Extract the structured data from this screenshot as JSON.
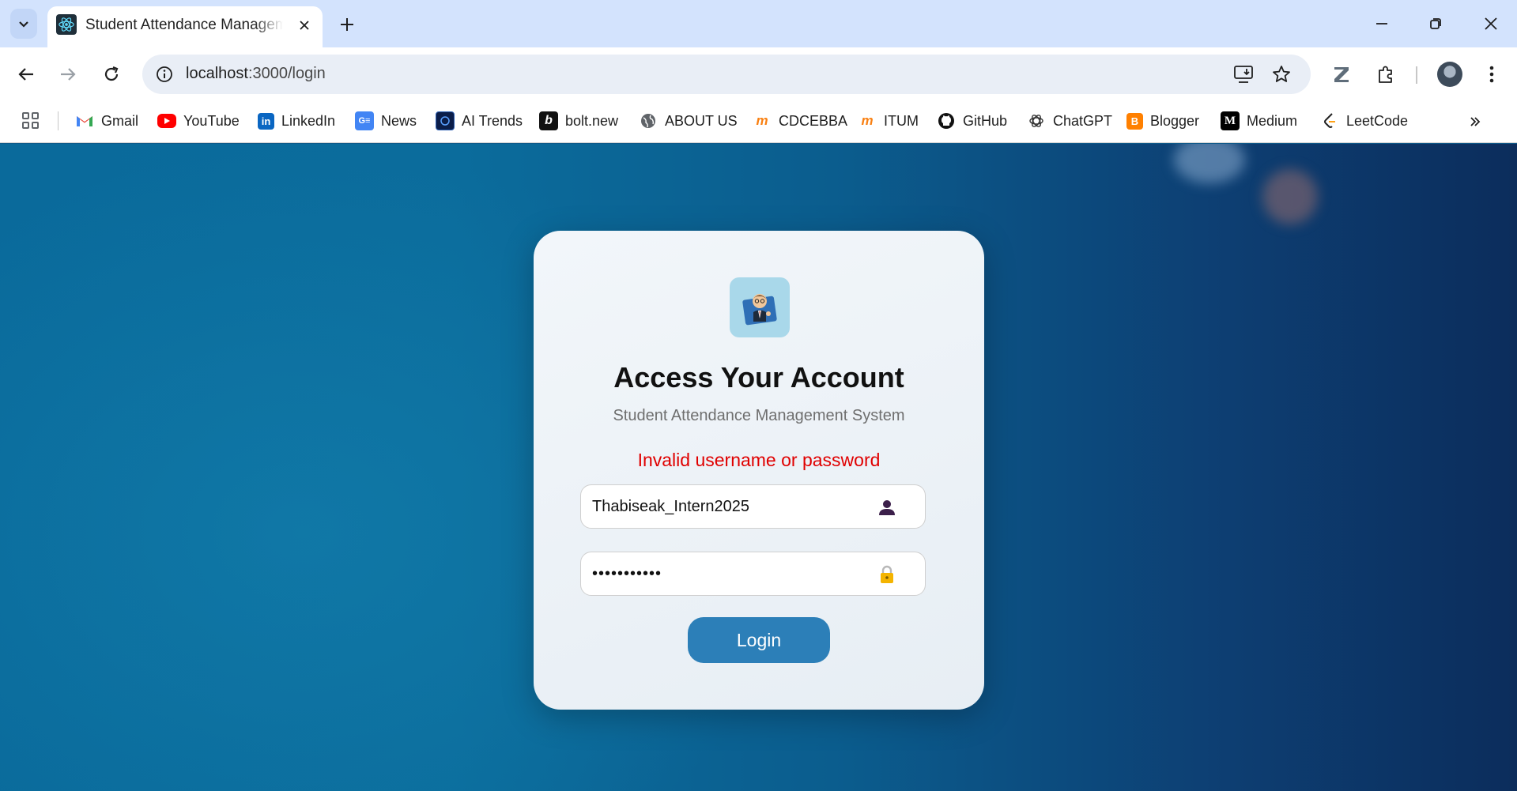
{
  "browser": {
    "tab_title": "Student Attendance Management System",
    "url_host": "localhost",
    "url_path": ":3000/login",
    "icons": {
      "tab_search": "chevron-down-icon",
      "new_tab": "plus-icon",
      "minimize": "minimize-icon",
      "restore": "restore-icon",
      "close": "close-icon",
      "back": "back-arrow-icon",
      "forward": "forward-arrow-icon",
      "reload": "reload-icon",
      "site_info": "info-icon",
      "install": "install-app-icon",
      "bookmark_star": "star-icon",
      "extension_z": "z-extension-icon",
      "extensions": "puzzle-icon",
      "menu": "kebab-menu-icon"
    }
  },
  "bookmarks": [
    {
      "label": "Gmail",
      "icon": "gmail-icon",
      "color": "#ea4335"
    },
    {
      "label": "YouTube",
      "icon": "youtube-icon",
      "color": "#ff0000"
    },
    {
      "label": "LinkedIn",
      "icon": "linkedin-icon",
      "color": "#0a66c2"
    },
    {
      "label": "News",
      "icon": "google-news-icon",
      "color": "#4285f4"
    },
    {
      "label": "AI Trends",
      "icon": "ai-trends-icon",
      "color": "#0b1e4a"
    },
    {
      "label": "bolt.new",
      "icon": "bolt-icon",
      "color": "#111111"
    },
    {
      "label": "ABOUT US",
      "icon": "globe-icon",
      "color": "#5f6368"
    },
    {
      "label": "CDCEBBA",
      "icon": "moodle-icon",
      "color": "#f98012"
    },
    {
      "label": "ITUM",
      "icon": "moodle-icon",
      "color": "#f98012"
    },
    {
      "label": "GitHub",
      "icon": "github-icon",
      "color": "#111111"
    },
    {
      "label": "ChatGPT",
      "icon": "chatgpt-icon",
      "color": "#333333"
    },
    {
      "label": "Blogger",
      "icon": "blogger-icon",
      "color": "#ff8000"
    },
    {
      "label": "Medium",
      "icon": "medium-icon",
      "color": "#000000"
    },
    {
      "label": "LeetCode",
      "icon": "leetcode-icon",
      "color": "#ffa116"
    }
  ],
  "login": {
    "title": "Access Your Account",
    "subtitle": "Student Attendance Management System",
    "error": "Invalid username or password",
    "username_value": "Thabiseak_Intern2025",
    "password_value": "•••••••••••",
    "button_label": "Login",
    "logo_icon": "student-avatar-icon",
    "username_icon": "user-icon",
    "password_icon": "lock-icon",
    "colors": {
      "error": "#e00000",
      "button": "#2c7fb8",
      "logo_bg": "#a9d8ea"
    }
  }
}
